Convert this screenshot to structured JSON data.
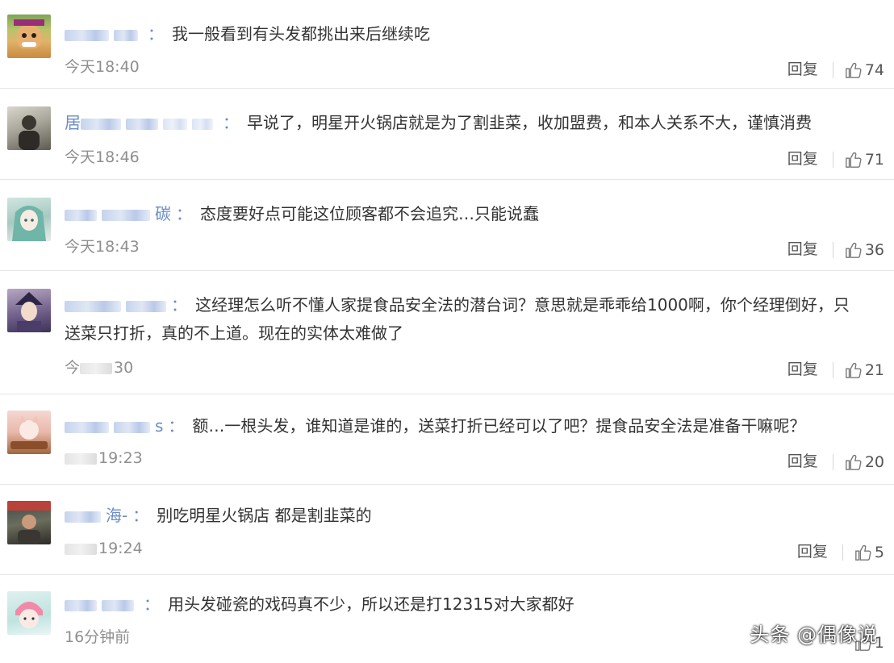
{
  "comments": [
    {
      "name_visible": "",
      "text": "我一般看到有头发都挑出来后继续吃",
      "time": "今天18:40",
      "reply": "回复",
      "likes": "74"
    },
    {
      "name_visible": "居",
      "text": "早说了，明星开火锅店就是为了割韭菜，收加盟费，和本人关系不大，谨慎消费",
      "time": "今天18:46",
      "reply": "回复",
      "likes": "71"
    },
    {
      "name_visible": "碳",
      "text": "态度要好点可能这位顾客都不会追究…只能说蠢",
      "time": "今天18:43",
      "reply": "回复",
      "likes": "36"
    },
    {
      "name_visible": "",
      "text": "这经理怎么听不懂人家提食品安全法的潜台词？意思就是乖乖给1000啊，你个经理倒好，只",
      "text2": "送菜只打折，真的不上道。现在的实体太难做了",
      "time": "30",
      "time_prefix": "今",
      "reply": "回复",
      "likes": "21"
    },
    {
      "name_visible": "s",
      "text": "额…一根头发，谁知道是谁的，送菜打折已经可以了吧？提食品安全法是准备干嘛呢？",
      "time": "19:23",
      "reply": "回复",
      "likes": "20"
    },
    {
      "name_visible": "海-",
      "text": "别吃明星火锅店 都是割韭菜的",
      "time": "19:24",
      "reply": "回复",
      "likes": "5"
    },
    {
      "name_visible": "",
      "text": "用头发碰瓷的戏码真不少，所以还是打12315对大家都好",
      "time": "16分钟前",
      "reply": "",
      "likes": "1"
    }
  ],
  "colon": "：",
  "watermark": "头条 @偶像说"
}
